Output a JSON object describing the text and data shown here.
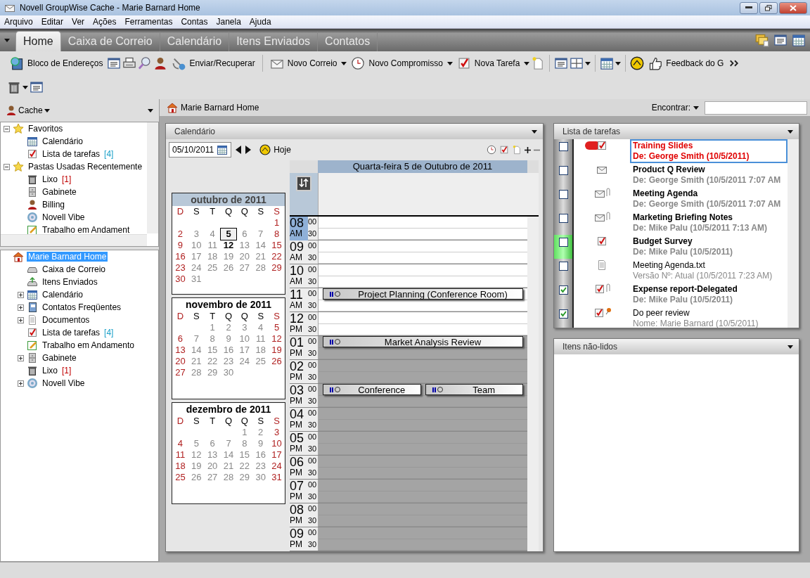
{
  "window": {
    "title": "Novell GroupWise Cache - Marie Barnard Home"
  },
  "menu": [
    "Arquivo",
    "Editar",
    "Ver",
    "Ações",
    "Ferramentas",
    "Contas",
    "Janela",
    "Ajuda"
  ],
  "tabs": [
    {
      "label": "Home",
      "selected": true
    },
    {
      "label": "Caixa de Correio",
      "selected": false
    },
    {
      "label": "Calendário",
      "selected": false
    },
    {
      "label": "Itens Enviados",
      "selected": false
    },
    {
      "label": "Contatos",
      "selected": false
    }
  ],
  "tab_icons": [
    {
      "kind": "folders"
    },
    {
      "kind": "window"
    },
    {
      "kind": "calendar"
    }
  ],
  "toolbar": [
    {
      "kind": "book",
      "label": "Bloco de Endereços"
    },
    {
      "kind": "window"
    },
    {
      "kind": "printer"
    },
    {
      "kind": "find"
    },
    {
      "kind": "person"
    },
    {
      "kind": "satellite",
      "label": "Enviar/Recuperar"
    },
    {
      "kind": "separator"
    },
    {
      "kind": "mail",
      "label": "Novo Correio"
    },
    {
      "kind": "caret"
    },
    {
      "kind": "clock",
      "label": "Novo Compromisso"
    },
    {
      "kind": "caret"
    },
    {
      "kind": "task",
      "label": "Nova Tarefa"
    },
    {
      "kind": "caret"
    },
    {
      "kind": "note"
    },
    {
      "kind": "separator"
    },
    {
      "kind": "window"
    },
    {
      "kind": "grid"
    },
    {
      "kind": "caret"
    },
    {
      "kind": "separator"
    },
    {
      "kind": "calendar"
    },
    {
      "kind": "caret"
    },
    {
      "kind": "separator"
    },
    {
      "kind": "vibe"
    },
    {
      "kind": "thumb",
      "label": "Feedback do G"
    },
    {
      "kind": "more"
    }
  ],
  "toolbar2": [
    {
      "kind": "trash"
    },
    {
      "kind": "caret"
    },
    {
      "kind": "window"
    }
  ],
  "cache": {
    "label": "Cache"
  },
  "favorites": [
    {
      "label": "Favoritos",
      "kind": "star",
      "expanded": true,
      "children": [
        {
          "label": "Calendário",
          "kind": "calendar"
        },
        {
          "label": "Lista de tarefas",
          "kind": "task",
          "count": "[4]",
          "color": "#1aa0c8"
        }
      ]
    },
    {
      "label": "Pastas Usadas Recentemente",
      "kind": "star",
      "expanded": true,
      "children": [
        {
          "label": "Lixo",
          "kind": "trash",
          "count": "[1]",
          "color": "#c00000"
        },
        {
          "label": "Gabinete",
          "kind": "cabinet"
        },
        {
          "label": "Billing",
          "kind": "person"
        },
        {
          "label": "Novell Vibe",
          "kind": "target"
        },
        {
          "label": "Trabalho em Andament",
          "kind": "pencil"
        }
      ]
    }
  ],
  "home_tree": [
    {
      "label": "Marie Barnard Home",
      "kind": "house",
      "selected": true,
      "children": [
        {
          "label": "Caixa de Correio",
          "kind": "inbox",
          "selected": false
        },
        {
          "label": "Itens Enviados",
          "kind": "outbox",
          "selected": false
        },
        {
          "label": "Calendário",
          "kind": "calendar",
          "expanded": false,
          "selected": false
        },
        {
          "label": "Contatos Freqüentes",
          "kind": "contacts",
          "expanded": false,
          "selected": false
        },
        {
          "label": "Documentos",
          "kind": "documents",
          "expanded": false,
          "selected": false
        },
        {
          "label": "Lista de tarefas",
          "kind": "task",
          "count": "[4]",
          "color": "#1aa0c8",
          "selected": false
        },
        {
          "label": "Trabalho em Andamento",
          "kind": "pencil",
          "selected": false
        },
        {
          "label": "Gabinete",
          "kind": "cabinet",
          "expanded": false,
          "selected": false
        },
        {
          "label": "Lixo",
          "kind": "trash",
          "count": "[1]",
          "color": "#c00000",
          "selected": false
        },
        {
          "label": "Novell Vibe",
          "kind": "target",
          "expanded": false,
          "selected": false
        }
      ]
    }
  ],
  "breadcrumb": {
    "label": "Marie Barnard Home"
  },
  "find": {
    "label": "Encontrar:"
  },
  "calendar": {
    "title": "Calendário",
    "date": "05/10/2011",
    "today": "Hoje",
    "months": [
      {
        "title": "outubro de 2011",
        "current": true,
        "weekdays": [
          "D",
          "S",
          "T",
          "Q",
          "Q",
          "S",
          "S"
        ],
        "weeks": [
          [
            {
              "day": "1",
              "selected": false,
              "busy": false
            }
          ],
          [
            {
              "day": "2",
              "selected": false,
              "busy": false
            },
            {
              "day": "3",
              "selected": false,
              "busy": false
            },
            {
              "day": "4",
              "selected": false,
              "busy": false
            },
            {
              "day": "5",
              "selected": true,
              "busy": true
            },
            {
              "day": "6",
              "selected": false,
              "busy": false
            },
            {
              "day": "7",
              "selected": false,
              "busy": false
            },
            {
              "day": "8",
              "selected": false,
              "busy": false
            }
          ],
          [
            {
              "day": "9",
              "selected": false,
              "busy": false
            },
            {
              "day": "10",
              "selected": false,
              "busy": false
            },
            {
              "day": "11",
              "selected": false,
              "busy": false
            },
            {
              "day": "12",
              "selected": false,
              "busy": true
            },
            {
              "day": "13",
              "selected": false,
              "busy": false
            },
            {
              "day": "14",
              "selected": false,
              "busy": false
            },
            {
              "day": "15",
              "selected": false,
              "busy": false
            }
          ],
          [
            {
              "day": "16",
              "selected": false,
              "busy": false
            },
            {
              "day": "17",
              "selected": false,
              "busy": false
            },
            {
              "day": "18",
              "selected": false,
              "busy": false
            },
            {
              "day": "19",
              "selected": false,
              "busy": false
            },
            {
              "day": "20",
              "selected": false,
              "busy": false
            },
            {
              "day": "21",
              "selected": false,
              "busy": false
            },
            {
              "day": "22",
              "selected": false,
              "busy": false
            }
          ],
          [
            {
              "day": "23",
              "selected": false,
              "busy": false
            },
            {
              "day": "24",
              "selected": false,
              "busy": false
            },
            {
              "day": "25",
              "selected": false,
              "busy": false
            },
            {
              "day": "26",
              "selected": false,
              "busy": false
            },
            {
              "day": "27",
              "selected": false,
              "busy": false
            },
            {
              "day": "28",
              "selected": false,
              "busy": false
            },
            {
              "day": "29",
              "selected": false,
              "busy": false
            }
          ],
          [
            {
              "day": "30",
              "selected": false,
              "busy": false
            },
            {
              "day": "31",
              "selected": false,
              "busy": false
            }
          ]
        ]
      },
      {
        "title": "novembro de 2011",
        "current": false,
        "weekdays": [
          "D",
          "S",
          "T",
          "Q",
          "Q",
          "S",
          "S"
        ],
        "weeks": [
          [
            {
              "day": "1",
              "selected": false,
              "busy": false
            },
            {
              "day": "2",
              "selected": false,
              "busy": false
            },
            {
              "day": "3",
              "selected": false,
              "busy": false
            },
            {
              "day": "4",
              "selected": false,
              "busy": false
            },
            {
              "day": "5",
              "selected": false,
              "busy": false
            }
          ],
          [
            {
              "day": "6",
              "selected": false,
              "busy": false
            },
            {
              "day": "7",
              "selected": false,
              "busy": false
            },
            {
              "day": "8",
              "selected": false,
              "busy": false
            },
            {
              "day": "9",
              "selected": false,
              "busy": false
            },
            {
              "day": "10",
              "selected": false,
              "busy": false
            },
            {
              "day": "11",
              "selected": false,
              "busy": false
            },
            {
              "day": "12",
              "selected": false,
              "busy": false
            }
          ],
          [
            {
              "day": "13",
              "selected": false,
              "busy": false
            },
            {
              "day": "14",
              "selected": false,
              "busy": false
            },
            {
              "day": "15",
              "selected": false,
              "busy": false
            },
            {
              "day": "16",
              "selected": false,
              "busy": false
            },
            {
              "day": "17",
              "selected": false,
              "busy": false
            },
            {
              "day": "18",
              "selected": false,
              "busy": false
            },
            {
              "day": "19",
              "selected": false,
              "busy": false
            }
          ],
          [
            {
              "day": "20",
              "selected": false,
              "busy": false
            },
            {
              "day": "21",
              "selected": false,
              "busy": false
            },
            {
              "day": "22",
              "selected": false,
              "busy": false
            },
            {
              "day": "23",
              "selected": false,
              "busy": false
            },
            {
              "day": "24",
              "selected": false,
              "busy": false
            },
            {
              "day": "25",
              "selected": false,
              "busy": false
            },
            {
              "day": "26",
              "selected": false,
              "busy": false
            }
          ],
          [
            {
              "day": "27",
              "selected": false,
              "busy": false
            },
            {
              "day": "28",
              "selected": false,
              "busy": false
            },
            {
              "day": "29",
              "selected": false,
              "busy": false
            },
            {
              "day": "30",
              "selected": false,
              "busy": false
            }
          ]
        ]
      },
      {
        "title": "dezembro de 2011",
        "current": false,
        "weekdays": [
          "D",
          "S",
          "T",
          "Q",
          "Q",
          "S",
          "S"
        ],
        "weeks": [
          [
            {
              "day": "1",
              "selected": false,
              "busy": false
            },
            {
              "day": "2",
              "selected": false,
              "busy": false
            },
            {
              "day": "3",
              "selected": false,
              "busy": false
            }
          ],
          [
            {
              "day": "4",
              "selected": false,
              "busy": false
            },
            {
              "day": "5",
              "selected": false,
              "busy": false
            },
            {
              "day": "6",
              "selected": false,
              "busy": false
            },
            {
              "day": "7",
              "selected": false,
              "busy": false
            },
            {
              "day": "8",
              "selected": false,
              "busy": false
            },
            {
              "day": "9",
              "selected": false,
              "busy": false
            },
            {
              "day": "10",
              "selected": false,
              "busy": false
            }
          ],
          [
            {
              "day": "11",
              "selected": false,
              "busy": false
            },
            {
              "day": "12",
              "selected": false,
              "busy": false
            },
            {
              "day": "13",
              "selected": false,
              "busy": false
            },
            {
              "day": "14",
              "selected": false,
              "busy": false
            },
            {
              "day": "15",
              "selected": false,
              "busy": false
            },
            {
              "day": "16",
              "selected": false,
              "busy": false
            },
            {
              "day": "17",
              "selected": false,
              "busy": false
            }
          ],
          [
            {
              "day": "18",
              "selected": false,
              "busy": false
            },
            {
              "day": "19",
              "selected": false,
              "busy": false
            },
            {
              "day": "20",
              "selected": false,
              "busy": false
            },
            {
              "day": "21",
              "selected": false,
              "busy": false
            },
            {
              "day": "22",
              "selected": false,
              "busy": false
            },
            {
              "day": "23",
              "selected": false,
              "busy": false
            },
            {
              "day": "24",
              "selected": false,
              "busy": false
            }
          ],
          [
            {
              "day": "25",
              "selected": false,
              "busy": false
            },
            {
              "day": "26",
              "selected": false,
              "busy": false
            },
            {
              "day": "27",
              "selected": false,
              "busy": false
            },
            {
              "day": "28",
              "selected": false,
              "busy": false
            },
            {
              "day": "29",
              "selected": false,
              "busy": false
            },
            {
              "day": "30",
              "selected": false,
              "busy": false
            },
            {
              "day": "31",
              "selected": false,
              "busy": false
            }
          ]
        ]
      }
    ],
    "day_title": "Quarta-feira 5 de Outubro de 2011",
    "hours": [
      {
        "hour": "08",
        "period": "AM",
        "minutes": [
          "00",
          "30"
        ],
        "selected": true,
        "work": true
      },
      {
        "hour": "09",
        "period": "AM",
        "minutes": [
          "00",
          "30"
        ],
        "selected": false,
        "work": true
      },
      {
        "hour": "10",
        "period": "AM",
        "minutes": [
          "00",
          "30"
        ],
        "selected": false,
        "work": true
      },
      {
        "hour": "11",
        "period": "AM",
        "minutes": [
          "00",
          "30"
        ],
        "selected": false,
        "work": true,
        "appointments": [
          {
            "title": "Project Planning (Conference Room)"
          }
        ]
      },
      {
        "hour": "12",
        "period": "PM",
        "minutes": [
          "00",
          "30"
        ],
        "selected": false,
        "work": true
      },
      {
        "hour": "01",
        "period": "PM",
        "minutes": [
          "00",
          "30"
        ],
        "selected": false,
        "work": false,
        "appointments": [
          {
            "title": "Market Analysis Review"
          }
        ]
      },
      {
        "hour": "02",
        "period": "PM",
        "minutes": [
          "00",
          "30"
        ],
        "selected": false,
        "work": false
      },
      {
        "hour": "03",
        "period": "PM",
        "minutes": [
          "00",
          "30"
        ],
        "selected": false,
        "work": false,
        "appointments": [
          {
            "title": "Conference"
          },
          {
            "title": "Team"
          }
        ]
      },
      {
        "hour": "04",
        "period": "PM",
        "minutes": [
          "00",
          "30"
        ],
        "selected": false,
        "work": false
      },
      {
        "hour": "05",
        "period": "PM",
        "minutes": [
          "00",
          "30"
        ],
        "selected": false,
        "work": false
      },
      {
        "hour": "06",
        "period": "PM",
        "minutes": [
          "00",
          "30"
        ],
        "selected": false,
        "work": false
      },
      {
        "hour": "07",
        "period": "PM",
        "minutes": [
          "00",
          "30"
        ],
        "selected": false,
        "work": false
      },
      {
        "hour": "08",
        "period": "PM",
        "minutes": [
          "00",
          "30"
        ],
        "selected": false,
        "work": false
      },
      {
        "hour": "09",
        "period": "PM",
        "minutes": [
          "00",
          "30"
        ],
        "selected": false,
        "work": false
      }
    ]
  },
  "tasks": {
    "title": "Lista de tarefas",
    "items": [
      {
        "kind": "task",
        "title": "Training Slides",
        "subtitle": "De: George Smith (10/5/2011)",
        "checked": false,
        "selected": true,
        "overdue": true,
        "unread": true,
        "attachment": false,
        "marked": false
      },
      {
        "kind": "mail",
        "title": "Product Q Review",
        "subtitle": "De: George Smith (10/5/2011 7:07 AM",
        "checked": false,
        "selected": false,
        "overdue": false,
        "unread": true,
        "attachment": false,
        "marked": false
      },
      {
        "kind": "mail",
        "title": "Meeting Agenda",
        "subtitle": "De: George Smith (10/5/2011 7:07 AM",
        "checked": false,
        "selected": false,
        "overdue": false,
        "unread": true,
        "attachment": true,
        "marked": false
      },
      {
        "kind": "mail",
        "title": "Marketing Briefing Notes",
        "subtitle": "De: Mike Palu (10/5/2011 7:13 AM)",
        "checked": false,
        "selected": false,
        "overdue": false,
        "unread": true,
        "attachment": true,
        "marked": false
      },
      {
        "kind": "task",
        "title": "Budget Survey",
        "subtitle": "De: Mike Palu (10/5/2011)",
        "checked": false,
        "selected": false,
        "overdue": false,
        "unread": true,
        "attachment": false,
        "marked": true
      },
      {
        "kind": "document",
        "title": "Meeting Agenda.txt",
        "subtitle": "Versão Nº: Atual (10/5/2011 7:23 AM)",
        "checked": false,
        "selected": false,
        "overdue": false,
        "unread": false,
        "attachment": false,
        "marked": false
      },
      {
        "kind": "task",
        "title": "Expense report-Delegated",
        "subtitle": "De: Mike Palu (10/5/2011)",
        "checked": true,
        "selected": false,
        "overdue": false,
        "unread": true,
        "attachment": true,
        "marked": false
      },
      {
        "kind": "pintask",
        "title": "Do peer review",
        "subtitle": "Nome: Marie Barnard (10/5/2011)",
        "checked": true,
        "selected": false,
        "overdue": false,
        "unread": false,
        "attachment": false,
        "marked": false
      }
    ]
  },
  "unread": {
    "title": "Itens não-lidos"
  }
}
